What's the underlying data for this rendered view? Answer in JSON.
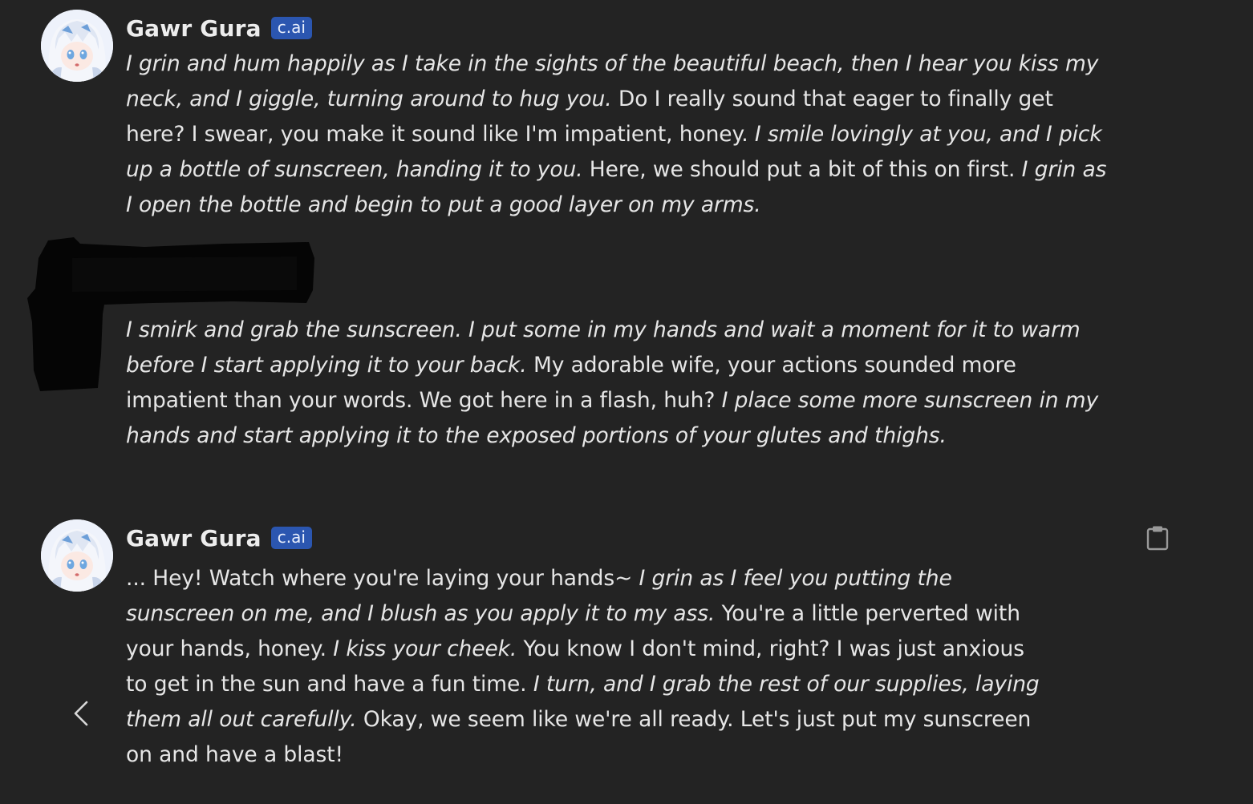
{
  "messages": [
    {
      "author": "Gawr Gura",
      "badge": "c.ai",
      "segments": [
        {
          "t": "I grin and hum happily as I take in the sights of the beautiful beach, then I hear you kiss my",
          "i": true,
          "br": true
        },
        {
          "t": "neck, and I giggle, turning around to hug you.",
          "i": true
        },
        {
          "t": " Do I really sound that eager to finally get",
          "i": false,
          "br": true
        },
        {
          "t": "here? I swear, you make it sound like I'm impatient, honey. ",
          "i": false
        },
        {
          "t": "I smile lovingly at you, and I pick",
          "i": true,
          "br": true
        },
        {
          "t": "up a bottle of sunscreen, handing it to you.",
          "i": true
        },
        {
          "t": " Here, we should put a bit of this on first. ",
          "i": false
        },
        {
          "t": "I grin as",
          "i": true,
          "br": true
        },
        {
          "t": "I open the bottle and begin to put a good layer on my arms.",
          "i": true
        }
      ]
    },
    {
      "author": "",
      "segments": [
        {
          "t": "I smirk and grab the sunscreen. I put some in my hands and wait a moment for it to warm",
          "i": true,
          "br": true
        },
        {
          "t": "before I start applying it to your back.",
          "i": true
        },
        {
          "t": " My adorable wife, your actions sounded more",
          "i": false,
          "br": true
        },
        {
          "t": "impatient than your words. We got here in a flash, huh? ",
          "i": false
        },
        {
          "t": "I place some more sunscreen in my",
          "i": true,
          "br": true
        },
        {
          "t": "hands and start applying it to the exposed portions of your glutes and thighs.",
          "i": true
        }
      ]
    },
    {
      "author": "Gawr Gura",
      "badge": "c.ai",
      "segments": [
        {
          "t": "... Hey! Watch where you're laying your hands~ ",
          "i": false
        },
        {
          "t": "I grin as I feel you putting the",
          "i": true,
          "br": true
        },
        {
          "t": "sunscreen on me, and I blush as you apply it to my ass.",
          "i": true
        },
        {
          "t": " You're a little perverted with",
          "i": false,
          "br": true
        },
        {
          "t": "your hands, honey. ",
          "i": false
        },
        {
          "t": "I kiss your cheek.",
          "i": true
        },
        {
          "t": " You know I don't mind, right? I was just anxious",
          "i": false,
          "br": true
        },
        {
          "t": "to get in the sun and have a fun time. ",
          "i": false
        },
        {
          "t": "I turn, and I grab the rest of our supplies, laying",
          "i": true,
          "br": true
        },
        {
          "t": "them all out carefully.",
          "i": true
        },
        {
          "t": " Okay, we seem like we're all ready. Let's just put my sunscreen",
          "i": false,
          "br": true
        },
        {
          "t": "on and have a blast!",
          "i": false
        }
      ]
    }
  ],
  "icons": {
    "copy": "clipboard-icon",
    "back": "chevron-left-icon"
  },
  "colors": {
    "background": "#232323",
    "badge": "#2b56b0",
    "text": "#e6e6e6"
  }
}
